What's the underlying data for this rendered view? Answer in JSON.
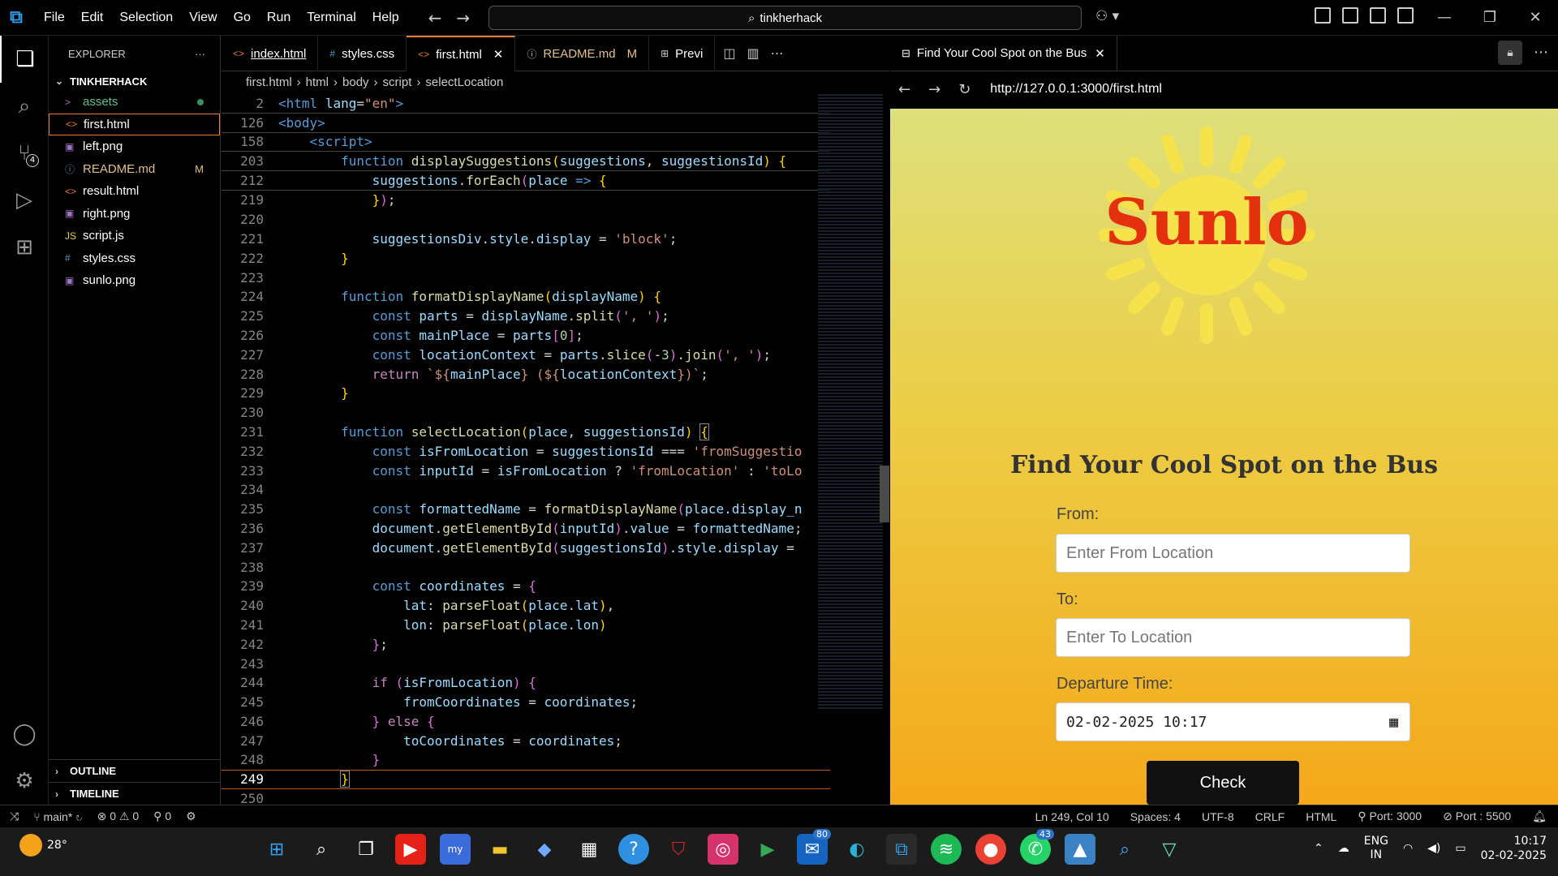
{
  "titlebar": {
    "menu": [
      "File",
      "Edit",
      "Selection",
      "View",
      "Go",
      "Run",
      "Terminal",
      "Help"
    ],
    "search_text": "tinkherhack"
  },
  "activity": {
    "source_control_badge": "4"
  },
  "explorer": {
    "title": "EXPLORER",
    "more": "···",
    "root": "TINKHERHACK",
    "files": [
      {
        "name": "assets",
        "icon": ">",
        "marker": "dot",
        "color": "#5cc28e"
      },
      {
        "name": "first.html",
        "icon": "<>",
        "marker": "",
        "color": "#ffffff"
      },
      {
        "name": "left.png",
        "icon": "▣",
        "marker": "",
        "color": "#ffffff"
      },
      {
        "name": "README.md",
        "icon": "ⓘ",
        "marker": "M",
        "color": "#e2c08d"
      },
      {
        "name": "result.html",
        "icon": "<>",
        "marker": "",
        "color": "#ffffff"
      },
      {
        "name": "right.png",
        "icon": "▣",
        "marker": "",
        "color": "#ffffff"
      },
      {
        "name": "script.js",
        "icon": "JS",
        "marker": "",
        "color": "#ffffff"
      },
      {
        "name": "styles.css",
        "icon": "#",
        "marker": "",
        "color": "#ffffff"
      },
      {
        "name": "sunlo.png",
        "icon": "▣",
        "marker": "",
        "color": "#ffffff"
      }
    ],
    "outline": "OUTLINE",
    "timeline": "TIMELINE"
  },
  "editor": {
    "tabs": [
      {
        "label": "index.html",
        "icon": "<>",
        "extra": ""
      },
      {
        "label": "styles.css",
        "icon": "#",
        "extra": ""
      },
      {
        "label": "first.html",
        "icon": "<>",
        "extra": "✕"
      },
      {
        "label": "README.md",
        "icon": "ⓘ",
        "extra": "M"
      },
      {
        "label": "Previ",
        "icon": "⊞",
        "extra": ""
      }
    ],
    "breadcrumb": [
      "first.html",
      "html",
      "body",
      "script",
      "selectLocation"
    ],
    "lines": [
      {
        "n": "2",
        "html": "<span class=\"t\">&lt;html</span> <span class=\"v\">lang</span>=<span class=\"s\">\"en\"</span><span class=\"t\">&gt;</span>"
      },
      {
        "n": "126",
        "html": "<span class=\"t\">&lt;body&gt;</span>"
      },
      {
        "n": "158",
        "html": "    <span class=\"t\">&lt;script&gt;</span>"
      },
      {
        "n": "203",
        "html": "        <span class=\"t\">function</span> <span class=\"f\">displaySuggestions</span><span class=\"b\">(</span><span class=\"v\">suggestions</span>, <span class=\"v\">suggestionsId</span><span class=\"b\">)</span> <span class=\"b\">{</span>"
      },
      {
        "n": "212",
        "html": "            <span class=\"v\">suggestions</span>.<span class=\"f\">forEach</span><span class=\"p\">(</span><span class=\"v\">place</span> <span class=\"t\">=&gt;</span> <span class=\"b\">{</span>"
      },
      {
        "n": "219",
        "html": "            <span class=\"b\">}</span><span class=\"p\">)</span>;"
      },
      {
        "n": "220",
        "html": ""
      },
      {
        "n": "221",
        "html": "            <span class=\"v\">suggestionsDiv</span>.<span class=\"v\">style</span>.<span class=\"v\">display</span> = <span class=\"s\">'block'</span>;"
      },
      {
        "n": "222",
        "html": "        <span class=\"b\">}</span>"
      },
      {
        "n": "223",
        "html": ""
      },
      {
        "n": "224",
        "html": "        <span class=\"t\">function</span> <span class=\"f\">formatDisplayName</span><span class=\"b\">(</span><span class=\"v\">displayName</span><span class=\"b\">)</span> <span class=\"b\">{</span>"
      },
      {
        "n": "225",
        "html": "            <span class=\"t\">const</span> <span class=\"v\">parts</span> = <span class=\"v\">displayName</span>.<span class=\"f\">split</span><span class=\"p\">(</span><span class=\"s\">', '</span><span class=\"p\">)</span>;"
      },
      {
        "n": "226",
        "html": "            <span class=\"t\">const</span> <span class=\"v\">mainPlace</span> = <span class=\"v\">parts</span><span class=\"p\">[</span><span class=\"n\">0</span><span class=\"p\">]</span>;"
      },
      {
        "n": "227",
        "html": "            <span class=\"t\">const</span> <span class=\"v\">locationContext</span> = <span class=\"v\">parts</span>.<span class=\"f\">slice</span><span class=\"p\">(</span>-<span class=\"n\">3</span><span class=\"p\">)</span>.<span class=\"f\">join</span><span class=\"p\">(</span><span class=\"s\">', '</span><span class=\"p\">)</span>;"
      },
      {
        "n": "228",
        "html": "            <span class=\"k\">return</span> <span class=\"s\">`${</span><span class=\"v\">mainPlace</span><span class=\"s\">} (${</span><span class=\"v\">locationContext</span><span class=\"s\">})`</span>;"
      },
      {
        "n": "229",
        "html": "        <span class=\"b\">}</span>"
      },
      {
        "n": "230",
        "html": ""
      },
      {
        "n": "231",
        "html": "        <span class=\"t\">function</span> <span class=\"f\">selectLocation</span><span class=\"b\">(</span><span class=\"v\">place</span>, <span class=\"v\">suggestionsId</span><span class=\"b\">)</span> <span class=\"b\" style=\"outline:1px solid #888\">{</span>"
      },
      {
        "n": "232",
        "html": "            <span class=\"t\">const</span> <span class=\"v\">isFromLocation</span> = <span class=\"v\">suggestionsId</span> === <span class=\"s\">'fromSuggestio</span>"
      },
      {
        "n": "233",
        "html": "            <span class=\"t\">const</span> <span class=\"v\">inputId</span> = <span class=\"v\">isFromLocation</span> ? <span class=\"s\">'fromLocation'</span> : <span class=\"s\">'toLo</span>"
      },
      {
        "n": "234",
        "html": ""
      },
      {
        "n": "235",
        "html": "            <span class=\"t\">const</span> <span class=\"v\">formattedName</span> = <span class=\"f\">formatDisplayName</span><span class=\"p\">(</span><span class=\"v\">place</span>.<span class=\"v\">display_n</span>"
      },
      {
        "n": "236",
        "html": "            <span class=\"v\">document</span>.<span class=\"f\">getElementById</span><span class=\"p\">(</span><span class=\"v\">inputId</span><span class=\"p\">)</span>.<span class=\"v\">value</span> = <span class=\"v\">formattedName</span>;"
      },
      {
        "n": "237",
        "html": "            <span class=\"v\">document</span>.<span class=\"f\">getElementById</span><span class=\"p\">(</span><span class=\"v\">suggestionsId</span><span class=\"p\">)</span>.<span class=\"v\">style</span>.<span class=\"v\">display</span> ="
      },
      {
        "n": "238",
        "html": ""
      },
      {
        "n": "239",
        "html": "            <span class=\"t\">const</span> <span class=\"v\">coordinates</span> = <span class=\"p\">{</span>"
      },
      {
        "n": "240",
        "html": "                <span class=\"v\">lat</span>: <span class=\"f\">parseFloat</span><span class=\"b\">(</span><span class=\"v\">place</span>.<span class=\"v\">lat</span><span class=\"b\">)</span>,"
      },
      {
        "n": "241",
        "html": "                <span class=\"v\">lon</span>: <span class=\"f\">parseFloat</span><span class=\"b\">(</span><span class=\"v\">place</span>.<span class=\"v\">lon</span><span class=\"b\">)</span>"
      },
      {
        "n": "242",
        "html": "            <span class=\"p\">}</span>;"
      },
      {
        "n": "243",
        "html": ""
      },
      {
        "n": "244",
        "html": "            <span class=\"k\">if</span> <span class=\"p\">(</span><span class=\"v\">isFromLocation</span><span class=\"p\">)</span> <span class=\"p\">{</span>"
      },
      {
        "n": "245",
        "html": "                <span class=\"v\">fromCoordinates</span> = <span class=\"v\">coordinates</span>;"
      },
      {
        "n": "246",
        "html": "            <span class=\"p\">}</span> <span class=\"k\">else</span> <span class=\"p\">{</span>"
      },
      {
        "n": "247",
        "html": "                <span class=\"v\">toCoordinates</span> = <span class=\"v\">coordinates</span>;"
      },
      {
        "n": "248",
        "html": "            <span class=\"p\">}</span>"
      },
      {
        "n": "249",
        "html": "        <span class=\"b\" style=\"outline:1px solid #888\">}</span>"
      },
      {
        "n": "250",
        "html": ""
      }
    ]
  },
  "browser": {
    "tab_title": "Find Your Cool Spot on the Bus",
    "url": "http://127.0.0.1:3000/first.html",
    "page": {
      "brand": "Sunlo",
      "heading": "Find Your Cool Spot on the Bus",
      "from_label": "From:",
      "from_placeholder": "Enter From Location",
      "to_label": "To:",
      "to_placeholder": "Enter To Location",
      "departure_label": "Departure Time:",
      "departure_value": "02-02-2025 10:17",
      "check_button": "Check"
    }
  },
  "statusbar": {
    "branch": "main*",
    "errors": "0",
    "warnings": "0",
    "ports": "0",
    "position": "Ln 249, Col 10",
    "spaces": "Spaces: 4",
    "encoding": "UTF-8",
    "eol": "CRLF",
    "language": "HTML",
    "port1": "Port: 3000",
    "port2": "Port : 5500"
  },
  "taskbar": {
    "weather": "28°",
    "badges": {
      "outlook": "80",
      "whatsapp": "43"
    },
    "lang_top": "ENG",
    "lang_bottom": "IN",
    "time": "10:17",
    "date": "02-02-2025"
  }
}
